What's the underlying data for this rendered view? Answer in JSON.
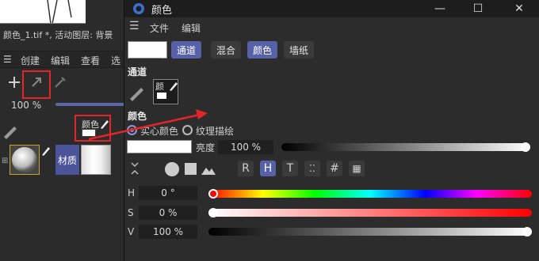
{
  "left_panel": {
    "status_text": "颜色_1.tif *, 活动图层: 背景",
    "menu": [
      "创建",
      "编辑",
      "查看",
      "选"
    ],
    "percent": "100 %",
    "material_name": "颜色",
    "material_tag": "材质"
  },
  "window": {
    "title": "颜色",
    "controls": {
      "minimize": "—",
      "maximize": "☐",
      "close": "✕"
    },
    "menu": [
      "文件",
      "编辑"
    ],
    "tabs": [
      {
        "label": "通道",
        "active": true
      },
      {
        "label": "混合",
        "active": false
      },
      {
        "label": "颜色",
        "active": true
      },
      {
        "label": "墙纸",
        "active": false
      }
    ],
    "section_channel": "通道",
    "channel_thumb_label": "颜",
    "section_color": "颜色",
    "radio_solid": "实心颜色",
    "radio_texture": "纹理描绘",
    "brightness_label": "亮度",
    "brightness_value": "100 %",
    "brightness_level": 1.0,
    "hsv": {
      "h_label": "H",
      "h_value": "0 °",
      "h_level": 0.0,
      "s_label": "S",
      "s_value": "0 %",
      "s_level": 0.0,
      "v_label": "V",
      "v_value": "100 %",
      "v_level": 1.0
    },
    "mode_buttons": [
      "R",
      "H",
      "T",
      "⁚⁚",
      "#",
      "▦"
    ],
    "active_mode": "H"
  },
  "colors": {
    "accent": "#5661a8",
    "annotation_red": "#e0262a"
  }
}
